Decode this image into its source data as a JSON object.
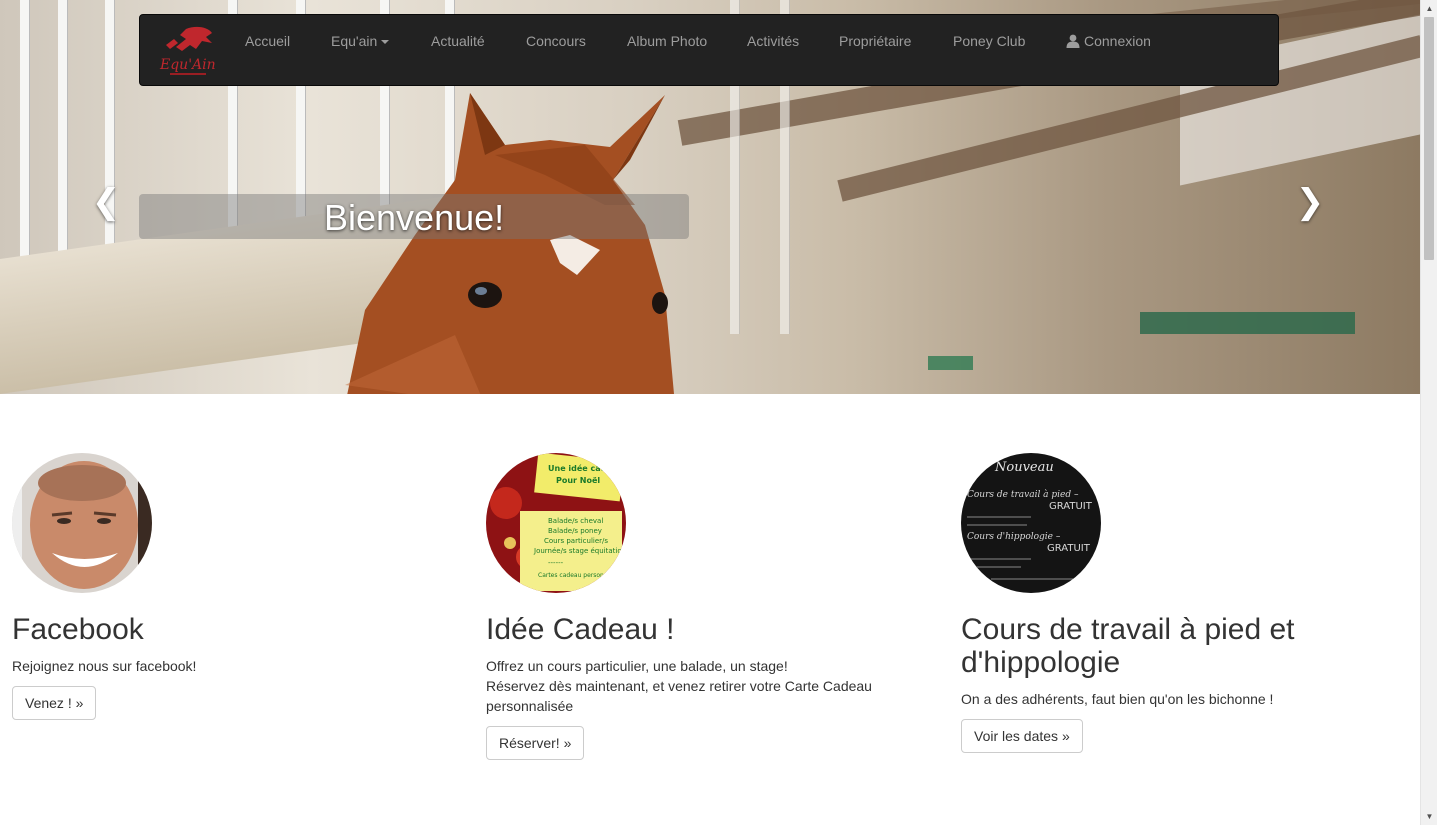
{
  "colors": {
    "navbar_bg": "#222222",
    "nav_text": "#9d9d9d",
    "logo_red": "#c0272d"
  },
  "nav": {
    "brand_icon": "equ-ain-horse-logo",
    "items": [
      {
        "label": "Accueil"
      },
      {
        "label": "Equ'ain",
        "dropdown": true
      },
      {
        "label": "Actualité"
      },
      {
        "label": "Concours"
      },
      {
        "label": "Album Photo"
      },
      {
        "label": "Activités"
      },
      {
        "label": "Propriétaire"
      },
      {
        "label": "Poney Club"
      },
      {
        "label": "Connexion",
        "icon": "user-icon"
      }
    ]
  },
  "carousel": {
    "caption": "Bienvenue!",
    "prev_icon": "chevron-left-icon",
    "next_icon": "chevron-right-icon"
  },
  "columns": [
    {
      "heading": "Facebook",
      "lines": [
        "Rejoignez nous sur facebook!"
      ],
      "button": "Venez ! »"
    },
    {
      "heading": "Idée Cadeau !",
      "lines": [
        "Offrez un cours particulier, une balade, un stage!",
        "Réservez dès maintenant, et venez retirer votre Carte Cadeau personnalisée"
      ],
      "button": "Réserver! »"
    },
    {
      "heading": "Cours de travail à pied et d'hippologie",
      "lines": [
        "On a des adhérents, faut bien qu'on les bichonne !"
      ],
      "button": "Voir les dates »"
    }
  ]
}
